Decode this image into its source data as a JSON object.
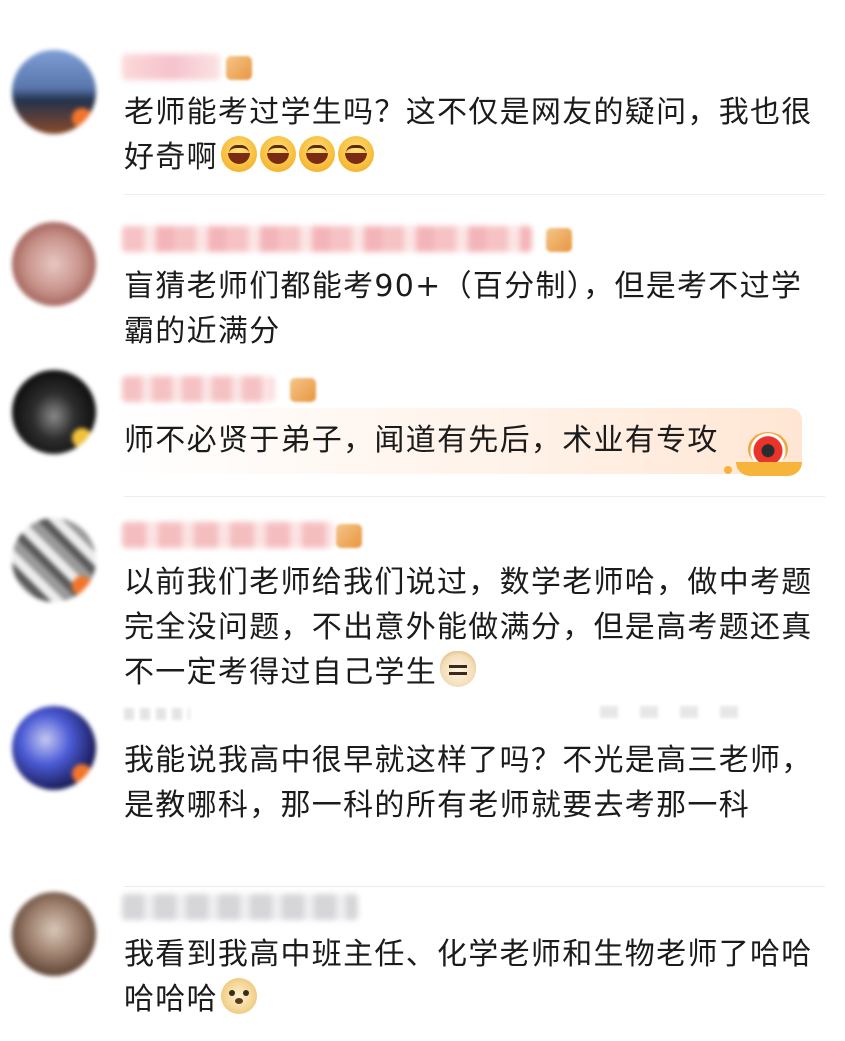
{
  "comments": [
    {
      "text": "老师能考过学生吗？这不仅是网友的疑问，我也很好奇啊",
      "emojis": [
        "laugh-emoji",
        "laugh-emoji",
        "laugh-emoji",
        "laugh-emoji"
      ]
    },
    {
      "text": "盲猜老师们都能考90+（百分制），但是考不过学霸的近满分",
      "emojis": []
    },
    {
      "text": "师不必贤于弟子，闻道有先后，术业有专攻",
      "emojis": [],
      "decoration": "coin-eye-sticker"
    },
    {
      "text": "以前我们老师给我们说过，数学老师哈，做中考题完全没问题，不出意外能做满分，但是高考题还真不一定考得过自己学生",
      "emojis": [
        "cat-emoji"
      ]
    },
    {
      "text": "我能说我高中很早就这样了吗？不光是高三老师，是教哪科，那一科的所有老师就要去考那一科",
      "emojis": []
    },
    {
      "text": "我看到我高中班主任、化学老师和生物老师了哈哈哈哈哈",
      "emojis": [
        "doge-emoji"
      ]
    }
  ],
  "colors": {
    "text": "#1b1b1b",
    "divider": "#ececec",
    "highlight": "#ffe6d4",
    "level_badge": "#e8963f"
  }
}
